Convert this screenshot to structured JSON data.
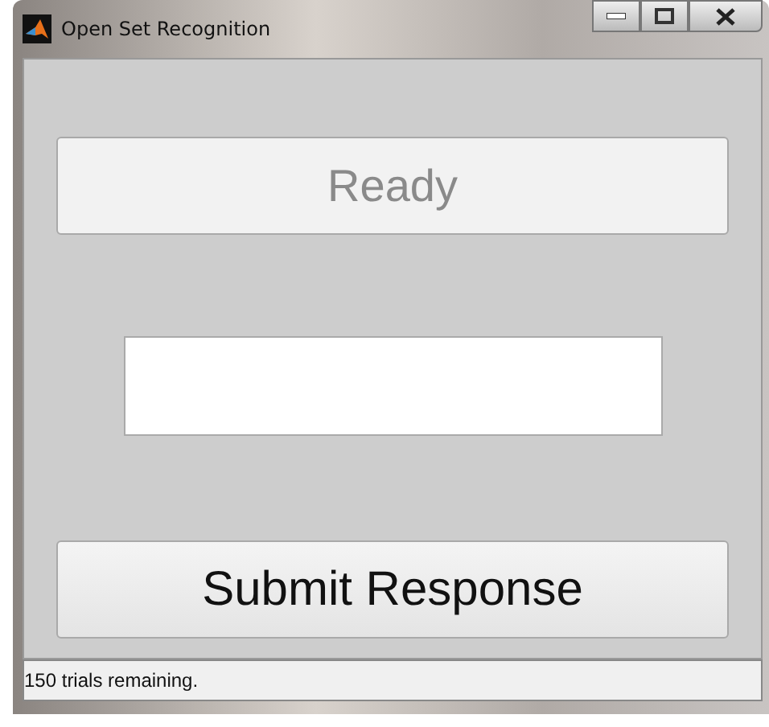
{
  "window": {
    "title": "Open Set Recognition"
  },
  "status_button": {
    "label": "Ready",
    "disabled": true
  },
  "submit_button": {
    "label": "Submit Response",
    "disabled": false
  },
  "status_bar": {
    "text": "150 trials remaining."
  }
}
